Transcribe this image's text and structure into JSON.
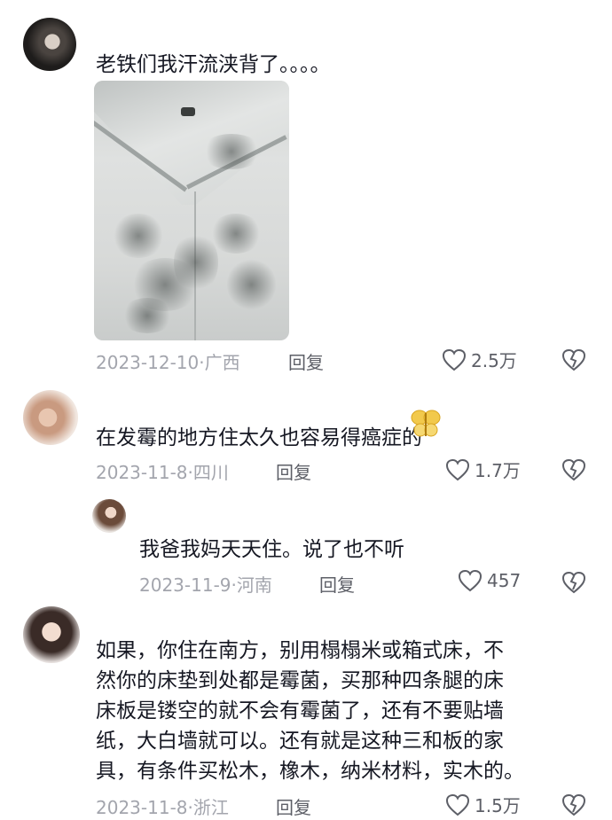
{
  "comments": [
    {
      "text": "老铁们我汗流浃背了。。。。",
      "date": "2023-12-10",
      "location": "广西",
      "reply_label": "回复",
      "likes": "2.5万",
      "has_photo": true
    },
    {
      "text": "在发霉的地方住太久也容易得癌症的",
      "date": "2023-11-8",
      "location": "四川",
      "reply_label": "回复",
      "likes": "1.7万"
    },
    {
      "text": "我爸我妈天天住。说了也不听",
      "date": "2023-11-9",
      "location": "河南",
      "reply_label": "回复",
      "likes": "457",
      "is_reply": true
    },
    {
      "lines": [
        "如果，你住在南方，别用榻榻米或箱式床，不",
        "然你的床垫到处都是霉菌，买那种四条腿的床",
        "床板是镂空的就不会有霉菌了，还有不要贴墙",
        "纸，大白墙就可以。还有就是这种三和板的家",
        "具，有条件买松木，橡木，纳米材料，实木的。"
      ],
      "date": "2023-11-8",
      "location": "浙江",
      "reply_label": "回复",
      "likes": "1.5万"
    }
  ],
  "separator": "·",
  "icons": {
    "like": "heart-outline-icon",
    "dislike": "broken-heart-icon",
    "sticker": "butterfly-sticker-icon"
  },
  "colors": {
    "text": "#161823",
    "meta": "#a3a5ad",
    "action": "#5d5f67",
    "sticker": "#f2c94c"
  }
}
